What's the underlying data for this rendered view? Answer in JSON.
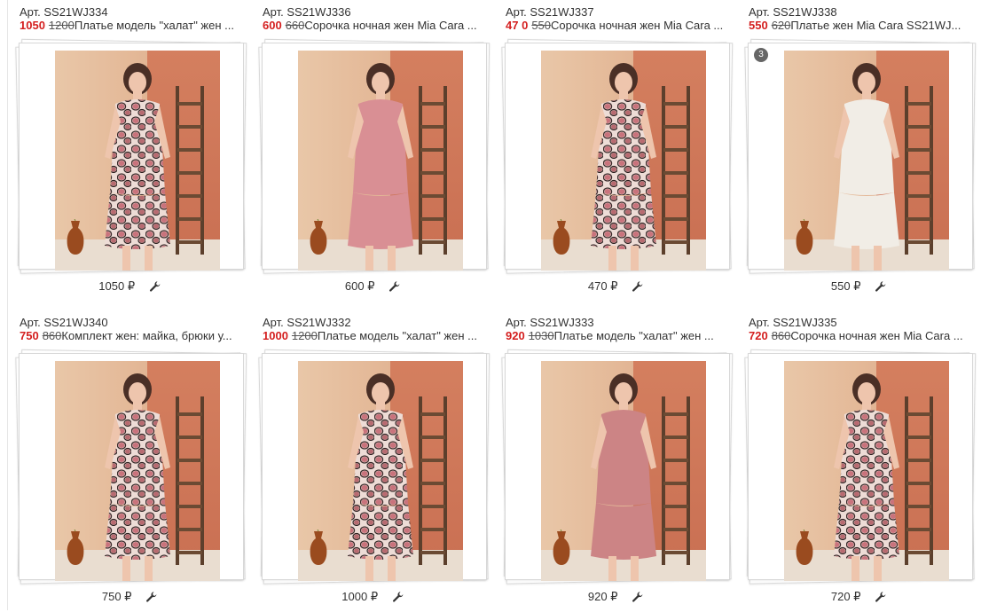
{
  "currency": "₽",
  "colors": {
    "price_new": "#d41f1f",
    "text": "#333333",
    "badge_bg": "#666666"
  },
  "products": [
    {
      "article": "Арт. SS21WJ334",
      "price_new": "1050",
      "price_old": "1200",
      "title": "Платье модель \"халат\" жен ...",
      "footer_price": "1050 ₽",
      "dress": "leopard",
      "badge": ""
    },
    {
      "article": "Арт. SS21WJ336",
      "price_new": "600",
      "price_old": "660",
      "title": "Сорочка ночная жен Mia Cara ...",
      "footer_price": "600 ₽",
      "dress": "pink",
      "badge": ""
    },
    {
      "article": "Арт. SS21WJ337",
      "price_new": "47 0",
      "price_old": "550",
      "title": "Сорочка ночная жен Mia Cara ...",
      "footer_price": "470 ₽",
      "dress": "leopard",
      "badge": ""
    },
    {
      "article": "Арт. SS21WJ338",
      "price_new": "550",
      "price_old": "620",
      "title": "Платье жен Mia Cara SS21WJ...",
      "footer_price": "550 ₽",
      "dress": "white",
      "badge": "3"
    },
    {
      "article": "Арт. SS21WJ340",
      "price_new": "750",
      "price_old": "860",
      "title": "Комплект жен: майка, брюки у...",
      "footer_price": "750 ₽",
      "dress": "leopard",
      "badge": ""
    },
    {
      "article": "Арт. SS21WJ332",
      "price_new": "1000",
      "price_old": "1200",
      "title": "Платье модель \"халат\" жен ...",
      "footer_price": "1000 ₽",
      "dress": "leopard",
      "badge": ""
    },
    {
      "article": "Арт. SS21WJ333",
      "price_new": "920",
      "price_old": "1030",
      "title": "Платье модель \"халат\" жен ...",
      "footer_price": "920 ₽",
      "dress": "rose",
      "badge": ""
    },
    {
      "article": "Арт. SS21WJ335",
      "price_new": "720",
      "price_old": "860",
      "title": "Сорочка ночная жен Mia Cara ...",
      "footer_price": "720 ₽",
      "dress": "leopard",
      "badge": ""
    }
  ]
}
